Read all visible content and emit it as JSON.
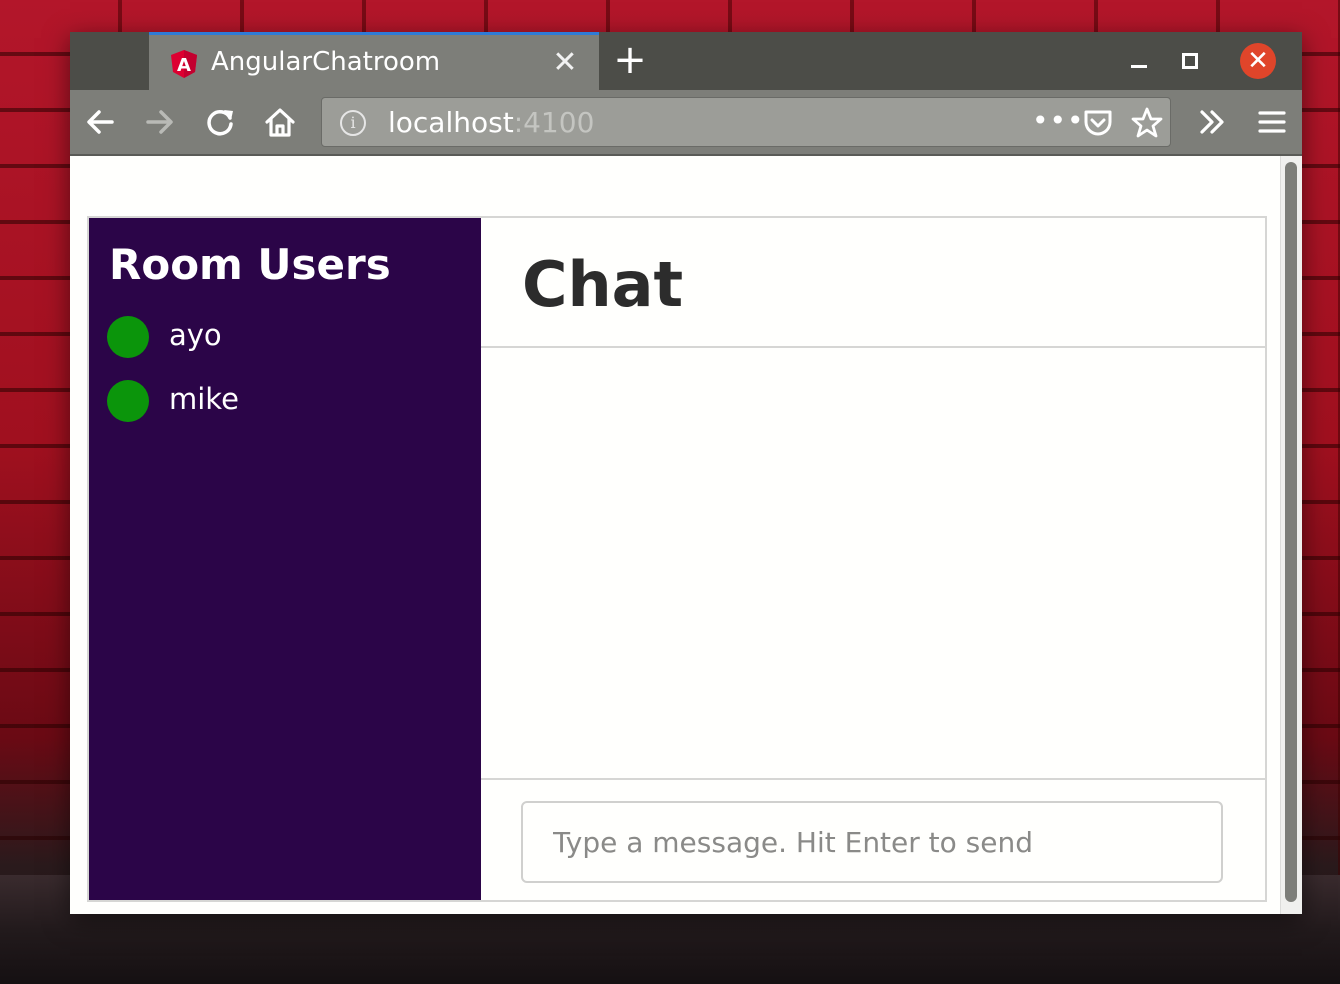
{
  "browser": {
    "tab_title": "AngularChatroom",
    "url_host": "localhost",
    "url_port": ":4100"
  },
  "app": {
    "sidebar_title": "Room Users",
    "users": [
      {
        "name": "ayo",
        "status_color": "#0b950b"
      },
      {
        "name": "mike",
        "status_color": "#0b950b"
      }
    ],
    "chat_title": "Chat",
    "message_placeholder": "Type a message. Hit Enter to send"
  },
  "colors": {
    "sidebar_bg": "#2b0548",
    "online": "#0b950b",
    "tab_accent": "#2f7bd6",
    "close_button": "#e0452a"
  },
  "icons": [
    "angular-icon",
    "close-icon",
    "plus-icon",
    "minimize-icon",
    "maximize-icon",
    "back-arrow-icon",
    "forward-arrow-icon",
    "reload-icon",
    "home-icon",
    "info-icon",
    "more-dots-icon",
    "pocket-icon",
    "star-icon",
    "overflow-chevrons-icon",
    "hamburger-menu-icon"
  ]
}
